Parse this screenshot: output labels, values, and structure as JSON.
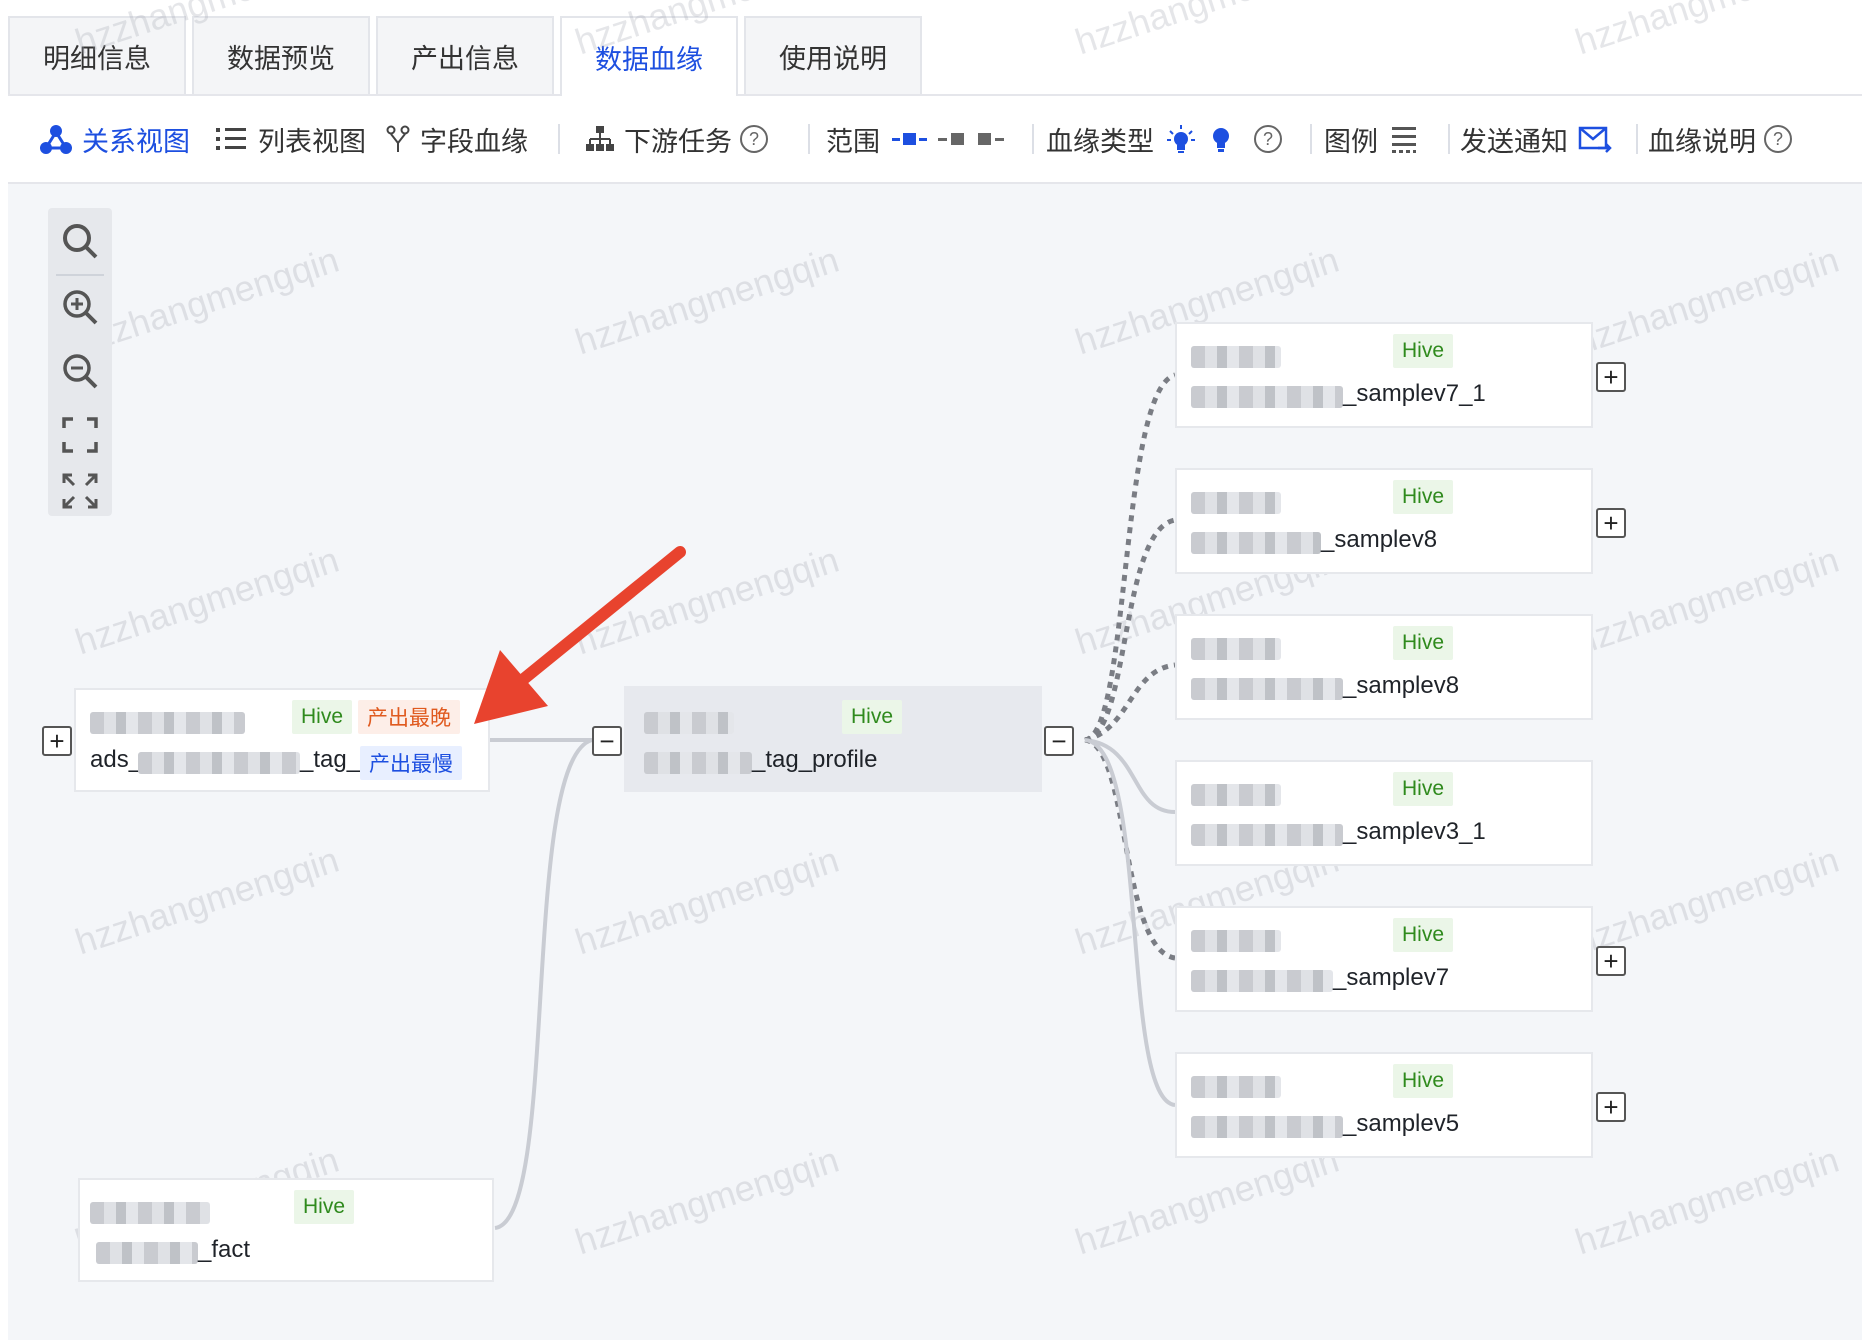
{
  "tabs": [
    {
      "label": "明细信息"
    },
    {
      "label": "数据预览"
    },
    {
      "label": "产出信息"
    },
    {
      "label": "数据血缘"
    },
    {
      "label": "使用说明"
    }
  ],
  "active_tab": "数据血缘",
  "toolbar": {
    "relation_view": "关系视图",
    "list_view": "列表视图",
    "field_lineage": "字段血缘",
    "downstream_tasks": "下游任务",
    "scope": "范围",
    "lineage_type": "血缘类型",
    "legend": "图例",
    "send_notice": "发送通知",
    "lineage_desc": "血缘说明",
    "help_glyph": "?"
  },
  "colors": {
    "accent": "#1d4fe0",
    "hive_green": "#2f8a1d",
    "late_orange": "#e05a1f"
  },
  "watermark": "hzzhangmengqin",
  "nodes": {
    "upstream_ads": {
      "name_prefix": "ads_",
      "name_suffix": "_tag_c",
      "type": "Hive",
      "badge_late": "产出最晚",
      "badge_slow": "产出最慢"
    },
    "upstream_fact": {
      "name_suffix": "_fact",
      "type": "Hive"
    },
    "center": {
      "name_suffix": "_tag_profile",
      "type": "Hive"
    },
    "downstream": [
      {
        "name_suffix": "_samplev7_1",
        "type": "Hive"
      },
      {
        "name_suffix": "_samplev8",
        "type": "Hive"
      },
      {
        "name_suffix": "_samplev8",
        "type": "Hive"
      },
      {
        "name_suffix": "_samplev3_1",
        "type": "Hive"
      },
      {
        "name_suffix": "_samplev7",
        "type": "Hive"
      },
      {
        "name_suffix": "_samplev5",
        "type": "Hive"
      }
    ]
  },
  "expand": {
    "plus": "+",
    "minus": "−"
  }
}
